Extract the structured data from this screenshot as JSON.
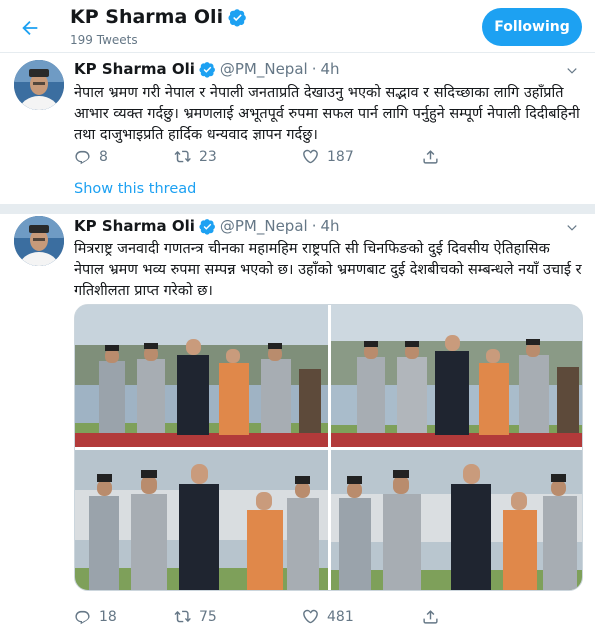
{
  "header": {
    "title": "KP Sharma Oli",
    "tweet_count": "199 Tweets",
    "follow_label": "Following"
  },
  "colors": {
    "accent": "#1da1f2",
    "text": "#14171a",
    "muted": "#657786",
    "border": "#e6ecf0"
  },
  "tweets": [
    {
      "name": "KP Sharma Oli",
      "handle": "@PM_Nepal",
      "dot": "·",
      "time": "4h",
      "text": "नेपाल भ्रमण गरी नेपाल र नेपाली जनताप्रति देखाउनु भएको सद्भाव र सदिच्छाका लागि उहाँप्रति आभार व्यक्त गर्दछु। भ्रमणलाई अभूतपूर्व रुपमा सफल पार्न लागि पर्नुहुने सम्पूर्ण नेपाली दिदीबहिनी तथा दाजुभाइप्रति हार्दिक धन्यवाद ज्ञापन गर्दछु।",
      "replies": "8",
      "retweets": "23",
      "likes": "187",
      "show_thread": "Show this thread"
    },
    {
      "name": "KP Sharma Oli",
      "handle": "@PM_Nepal",
      "dot": "·",
      "time": "4h",
      "text": "मित्रराष्ट्र जनवादी गणतन्त्र चीनका महामहिम राष्ट्रपति सी चिनफिङको दुई दिवसीय ऐतिहासिक नेपाल भ्रमण भव्य रुपमा सम्पन्न भएको छ। उहाँको भ्रमणबाट दुई देशबीचको सम्बन्धले नयाँ उचाई र गतिशीलता प्राप्त गरेको छ।",
      "replies": "18",
      "retweets": "75",
      "likes": "481"
    }
  ],
  "icons": [
    "back-arrow-icon",
    "verified-badge-icon",
    "caret-down-icon",
    "reply-icon",
    "retweet-icon",
    "like-icon",
    "share-icon"
  ]
}
